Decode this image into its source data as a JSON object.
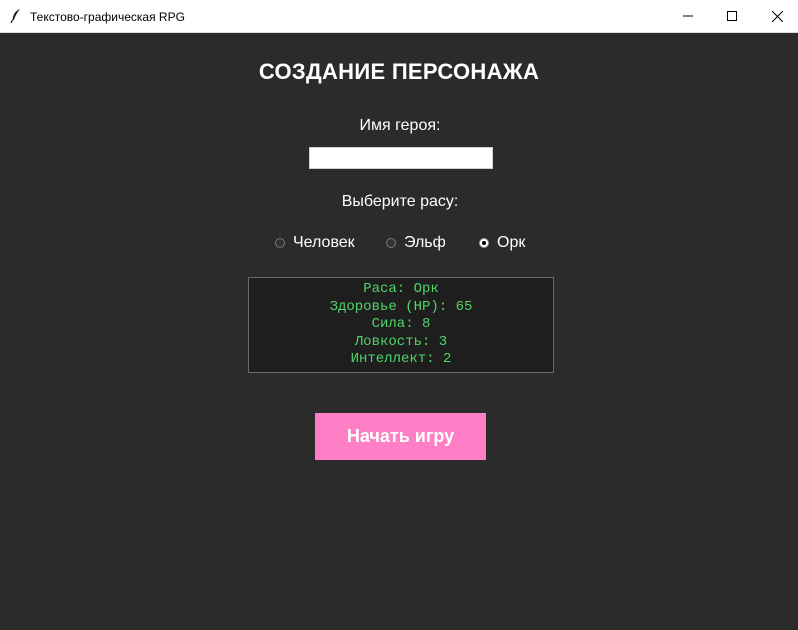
{
  "window": {
    "title": "Текстово-графическая RPG",
    "icon": "feather-icon",
    "controls": [
      "minimize-icon",
      "maximize-icon",
      "close-icon"
    ]
  },
  "screen": {
    "heading": "СОЗДАНИЕ ПЕРСОНАЖА",
    "name_label": "Имя героя:",
    "name_value": "",
    "race_label": "Выберите расу:",
    "races": [
      {
        "label": "Человек",
        "selected": false
      },
      {
        "label": "Эльф",
        "selected": false
      },
      {
        "label": "Орк",
        "selected": true
      }
    ],
    "stats": [
      "Раса: Орк",
      "Здоровье (HP): 65",
      "Сила: 8",
      "Ловкость: 3",
      "Интеллект: 2"
    ],
    "start_button": "Начать игру"
  },
  "colors": {
    "background": "#2b2b2b",
    "stats_background": "#1e1e1e",
    "stats_text": "#4fd56a",
    "button_background": "#ff7fc7",
    "button_text": "#ffffff"
  }
}
